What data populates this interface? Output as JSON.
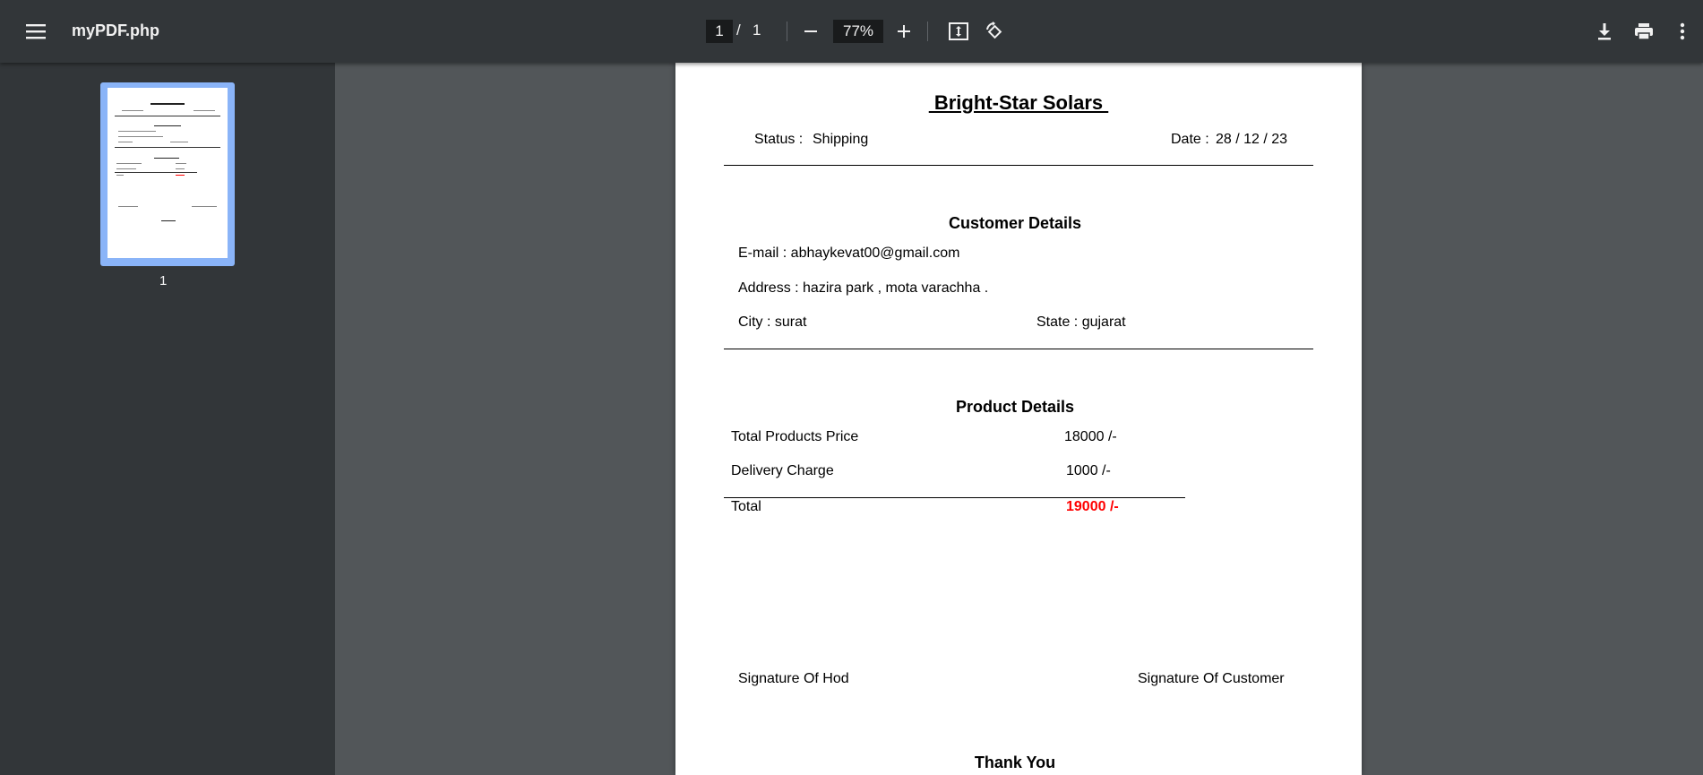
{
  "toolbar": {
    "file_name": "myPDF.php",
    "current_page": "1",
    "page_separator": "/",
    "total_pages": "1",
    "zoom": "77%",
    "icons": [
      "menu-icon",
      "zoom-out-icon",
      "zoom-in-icon",
      "fit-page-icon",
      "rotate-icon",
      "download-icon",
      "print-icon",
      "more-icon"
    ]
  },
  "sidebar": {
    "thumbnail_label": "1",
    "accent_color": "#8ab4f8"
  },
  "document": {
    "company": " Bright-Star Solars ",
    "status_label": "Status :",
    "status_value": "Shipping",
    "date_label": "Date :",
    "date_value": "28 / 12 / 23",
    "customer_heading": "Customer Details",
    "email": "E-mail : abhaykevat00@gmail.com",
    "address": "Address : hazira park , mota varachha .",
    "city": "City : surat",
    "state": "State : gujarat",
    "product_heading": "Product Details",
    "rows": [
      {
        "label": "Total Products Price",
        "value": "18000 /-"
      },
      {
        "label": "Delivery Charge",
        "value": "1000 /-"
      }
    ],
    "total_label": "Total",
    "total_value": "19000 /-",
    "total_color": "#ff0000",
    "signature_hod": "Signature Of Hod",
    "signature_customer": "Signature Of Customer",
    "closing": "Thank You"
  }
}
